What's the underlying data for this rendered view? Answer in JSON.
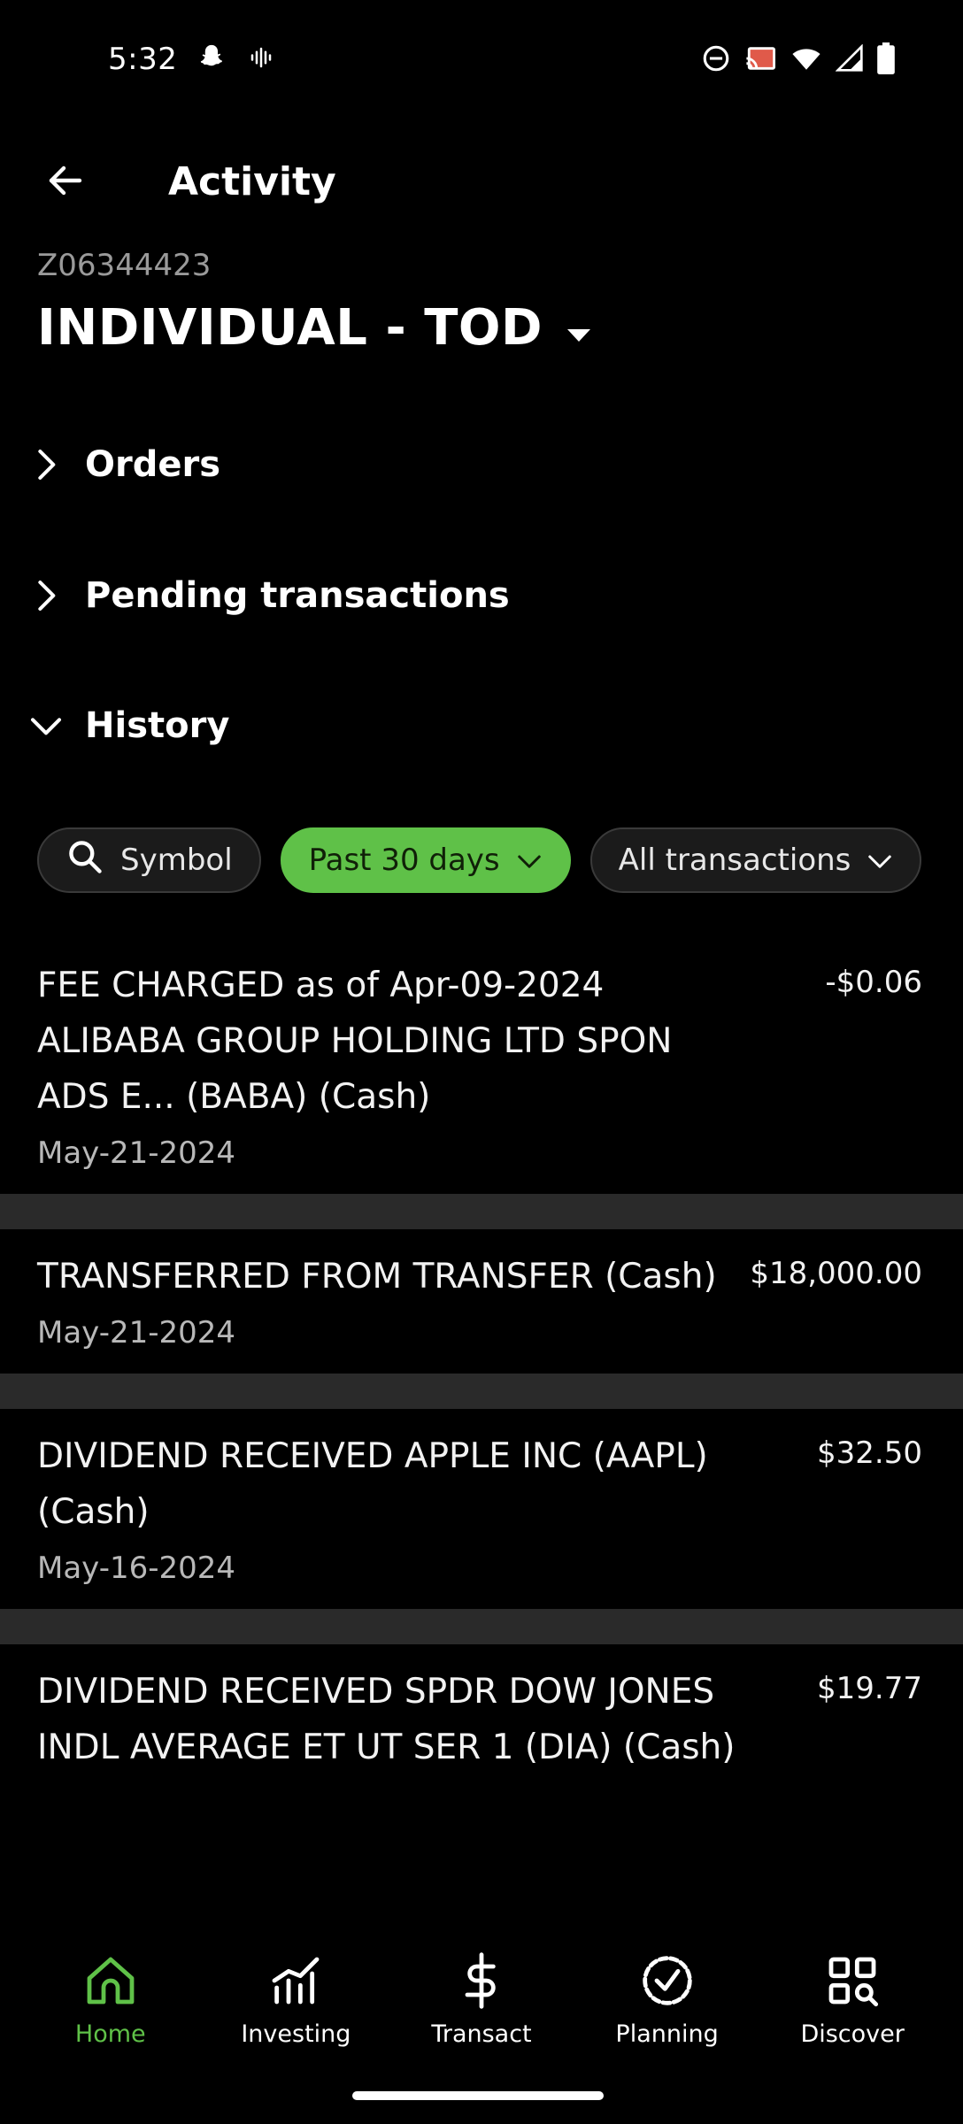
{
  "status_bar": {
    "time": "5:32",
    "left_icons": [
      "snapchat-icon",
      "voice-icon"
    ],
    "right_icons": [
      "do-not-disturb-icon",
      "cast-icon",
      "wifi-icon",
      "signal-icon",
      "battery-icon"
    ]
  },
  "header": {
    "title": "Activity",
    "back_icon": "arrow-left-icon"
  },
  "account": {
    "number": "Z06344423",
    "name": "INDIVIDUAL - TOD"
  },
  "sections": [
    {
      "label": "Orders",
      "expanded": false
    },
    {
      "label": "Pending transactions",
      "expanded": false
    },
    {
      "label": "History",
      "expanded": true
    }
  ],
  "filters": {
    "symbol": "Symbol",
    "period": "Past 30 days",
    "type": "All transactions"
  },
  "transactions": [
    {
      "description": "FEE CHARGED as of Apr-09-2024 ALIBABA GROUP HOLDING LTD SPON ADS E... (BABA) (Cash)",
      "amount": "-$0.06",
      "date": "May-21-2024"
    },
    {
      "description": "TRANSFERRED FROM TRANSFER (Cash)",
      "amount": "$18,000.00",
      "date": "May-21-2024"
    },
    {
      "description": "DIVIDEND RECEIVED APPLE INC (AAPL) (Cash)",
      "amount": "$32.50",
      "date": "May-16-2024"
    },
    {
      "description": "DIVIDEND RECEIVED SPDR DOW JONES INDL AVERAGE ET UT SER 1 (DIA) (Cash)",
      "amount": "$19.77",
      "date": ""
    }
  ],
  "bottom_nav": [
    {
      "label": "Home",
      "icon": "home-icon",
      "active": true
    },
    {
      "label": "Investing",
      "icon": "chart-icon",
      "active": false
    },
    {
      "label": "Transact",
      "icon": "dollar-icon",
      "active": false
    },
    {
      "label": "Planning",
      "icon": "check-circle-icon",
      "active": false
    },
    {
      "label": "Discover",
      "icon": "grid-search-icon",
      "active": false
    }
  ],
  "colors": {
    "accent": "#5fc148",
    "background": "#000000",
    "separator": "#2a2a2a"
  }
}
